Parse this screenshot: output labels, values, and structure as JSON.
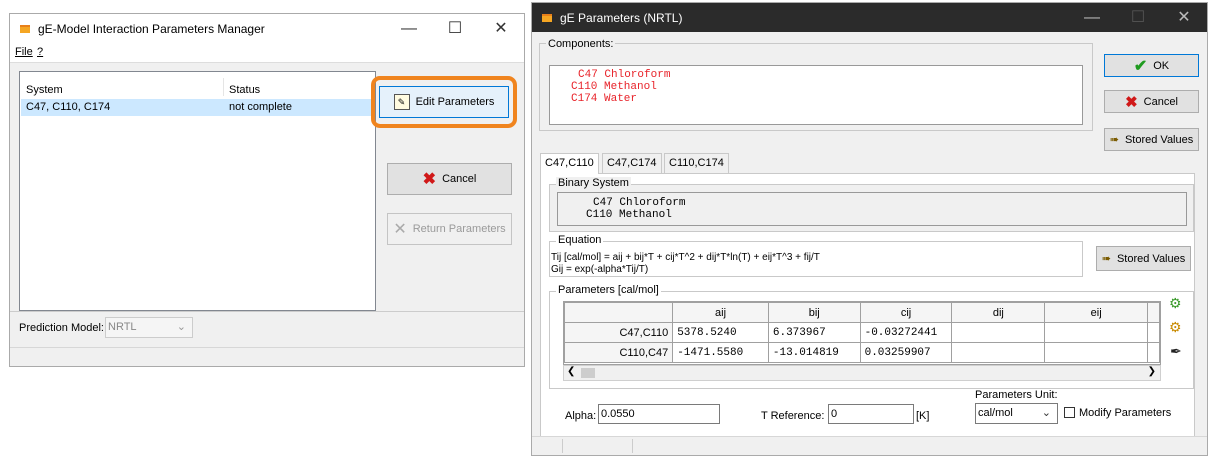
{
  "left_window": {
    "title": "gE-Model Interaction Parameters Manager",
    "menu": [
      "File",
      "?"
    ],
    "list_headers": [
      "System",
      "Status"
    ],
    "list_rows": [
      {
        "system": "C47, C110, C174",
        "status": "not complete"
      }
    ],
    "edit_button": "Edit Parameters",
    "cancel_button": "Cancel",
    "return_button": "Return Parameters",
    "prediction_label": "Prediction Model:",
    "prediction_value": "NRTL"
  },
  "right_window": {
    "title": "gE Parameters (NRTL)",
    "components_label": "Components:",
    "components": [
      "C47 Chloroform",
      "C110 Methanol",
      "C174 Water"
    ],
    "ok_button": "OK",
    "cancel_button": "Cancel",
    "stored_values_button": "Stored Values",
    "tabs": [
      "C47,C110",
      "C47,C174",
      "C110,C174"
    ],
    "binary_system_label": "Binary System",
    "binary_components": [
      "C47 Chloroform",
      "C110 Methanol"
    ],
    "equation_label": "Equation",
    "equation_line1": "Tij [cal/mol] = aij + bij*T + cij*T^2 + dij*T*ln(T) + eij*T^3 + fij/T",
    "equation_line2": "Gij = exp(-alpha*Tij/T)",
    "equation_stored_values": "Stored Values",
    "parameters_label": "Parameters [cal/mol]",
    "param_headers": [
      "aij",
      "bij",
      "cij",
      "dij",
      "eij"
    ],
    "param_rows": [
      {
        "label": "C47,C110",
        "values": [
          "5378.5240",
          "6.373967",
          "-0.03272441",
          "",
          ""
        ]
      },
      {
        "label": "C110,C47",
        "values": [
          "-1471.5580",
          "-13.014819",
          "0.03259907",
          "",
          ""
        ]
      }
    ],
    "alpha_label": "Alpha:",
    "alpha_value": "0.0550",
    "t_ref_label": "T Reference:",
    "t_ref_value": "0",
    "t_ref_unit": "[K]",
    "units_label": "Parameters Unit:",
    "units_value": "cal/mol",
    "modify_label": "Modify Parameters"
  },
  "colors": {
    "highlight": "#f0841e",
    "selection": "#cce8ff",
    "component_red": "#e8232a"
  }
}
